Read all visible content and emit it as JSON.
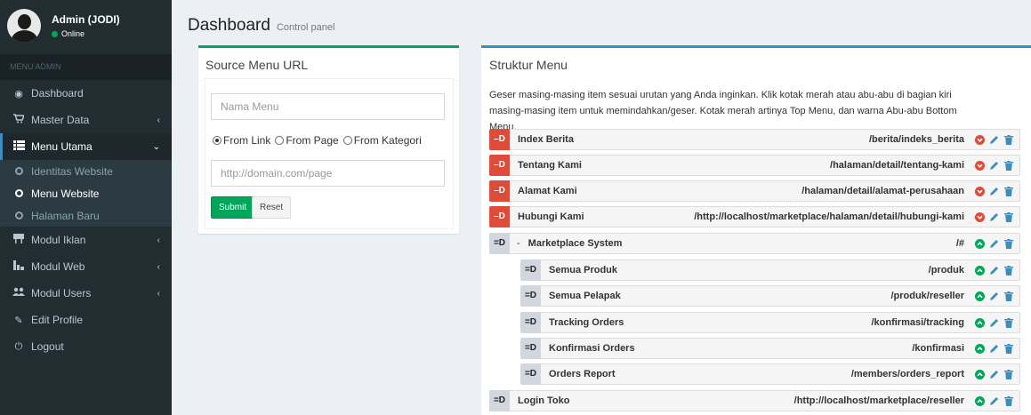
{
  "user": {
    "name": "Admin (JODI)",
    "status": "Online"
  },
  "sidebar": {
    "header": "MENU ADMIN",
    "items": [
      {
        "label": "Dashboard",
        "icon": "dashboard-icon"
      },
      {
        "label": "Master Data",
        "icon": "cart-icon"
      },
      {
        "label": "Menu Utama",
        "icon": "list-icon"
      },
      {
        "label": "Modul Iklan",
        "icon": "ad-icon"
      },
      {
        "label": "Modul Web",
        "icon": "web-icon"
      },
      {
        "label": "Modul Users",
        "icon": "users-icon"
      },
      {
        "label": "Edit Profile",
        "icon": "edit-icon"
      },
      {
        "label": "Logout",
        "icon": "power-icon"
      }
    ],
    "submenu": [
      "Identitas Website",
      "Menu Website",
      "Halaman Baru"
    ]
  },
  "header": {
    "title": "Dashboard",
    "subtitle": "Control panel"
  },
  "source_box": {
    "title": "Source Menu URL",
    "name_placeholder": "Nama Menu",
    "radios": [
      "From Link",
      "From Page",
      "From Kategori"
    ],
    "link_placeholder": "http://domain.com/page",
    "submit_label": "Submit",
    "reset_label": "Reset"
  },
  "struktur": {
    "title": "Struktur Menu",
    "description": "Geser masing-masing item sesuai urutan yang Anda inginkan. Klik kotak merah atau abu-abu di bagian kiri masing-masing item untuk memindahkan/geser. Kotak merah artinya Top Menu, dan warna Abu-abu Bottom Menu.",
    "items": [
      {
        "handle": "–D",
        "label": "Index Berita",
        "url": "/berita/indeks_berita",
        "type": "top"
      },
      {
        "handle": "–D",
        "label": "Tentang Kami",
        "url": "/halaman/detail/tentang-kami",
        "type": "top"
      },
      {
        "handle": "–D",
        "label": "Alamat Kami",
        "url": "/halaman/detail/alamat-perusahaan",
        "type": "top"
      },
      {
        "handle": "–D",
        "label": "Hubungi Kami",
        "url": "/http://localhost/marketplace/halaman/detail/hubungi-kami",
        "type": "top"
      },
      {
        "handle": "=D",
        "label": "Marketplace System",
        "url": "/#",
        "type": "bottom"
      },
      {
        "handle": "=D",
        "label": "Semua Produk",
        "url": "/produk",
        "type": "bottom"
      },
      {
        "handle": "=D",
        "label": "Semua Pelapak",
        "url": "/produk/reseller",
        "type": "bottom"
      },
      {
        "handle": "=D",
        "label": "Tracking Orders",
        "url": "/konfirmasi/tracking",
        "type": "bottom"
      },
      {
        "handle": "=D",
        "label": "Konfirmasi Orders",
        "url": "/konfirmasi",
        "type": "bottom"
      },
      {
        "handle": "=D",
        "label": "Orders Report",
        "url": "/members/orders_report",
        "type": "bottom"
      },
      {
        "handle": "=D",
        "label": "Login Toko",
        "url": "/http://localhost/marketplace/reseller",
        "type": "bottom"
      }
    ],
    "minus": "-"
  },
  "colors": {
    "sidebar": "#222d32",
    "accent_green": "#00a65a",
    "accent_blue": "#3c8dbc",
    "red": "#dd4b39"
  }
}
